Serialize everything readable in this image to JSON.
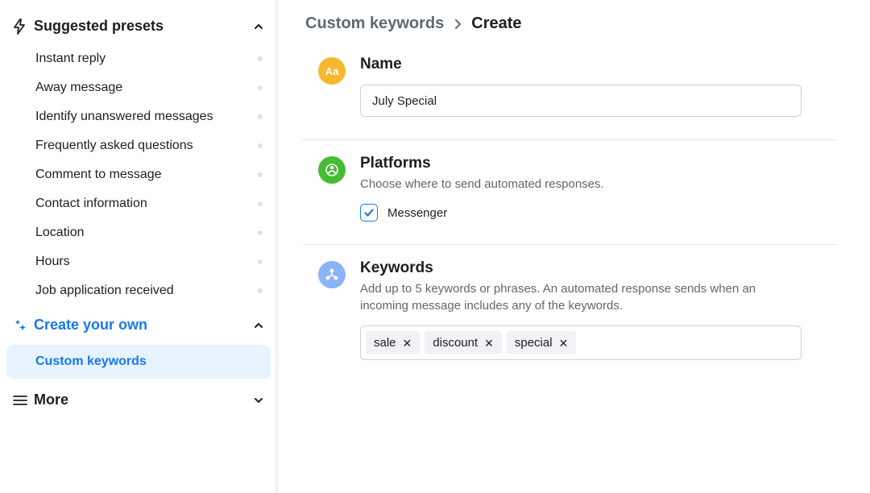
{
  "sidebar": {
    "presets_header": "Suggested presets",
    "presets": [
      {
        "label": "Instant reply"
      },
      {
        "label": "Away message"
      },
      {
        "label": "Identify unanswered messages"
      },
      {
        "label": "Frequently asked questions"
      },
      {
        "label": "Comment to message"
      },
      {
        "label": "Contact information"
      },
      {
        "label": "Location"
      },
      {
        "label": "Hours"
      },
      {
        "label": "Job application received"
      }
    ],
    "create_own_header": "Create your own",
    "custom_keywords": "Custom keywords",
    "more": "More"
  },
  "breadcrumb": {
    "parent": "Custom keywords",
    "current": "Create"
  },
  "name_section": {
    "badge_text": "Aa",
    "title": "Name",
    "value": "July Special"
  },
  "platforms_section": {
    "title": "Platforms",
    "desc": "Choose where to send automated responses.",
    "messenger_label": "Messenger",
    "messenger_checked": true
  },
  "keywords_section": {
    "title": "Keywords",
    "desc": "Add up to 5 keywords or phrases. An automated response sends when an incoming message includes any of the keywords.",
    "tags": [
      "sale",
      "discount",
      "special"
    ]
  }
}
